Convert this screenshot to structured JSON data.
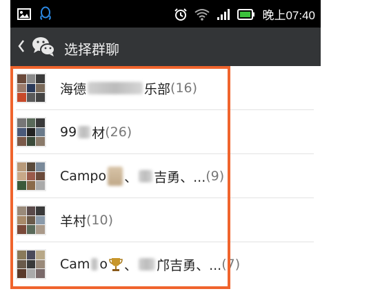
{
  "status_bar": {
    "time": "晚上07:40",
    "icons": [
      "image-icon",
      "qq-icon",
      "alarm-icon",
      "wifi-icon",
      "signal-icon",
      "battery-icon"
    ]
  },
  "header": {
    "back_icon": "chevron-left-icon",
    "app_icon": "wechat-icon",
    "title": "选择群聊"
  },
  "groups": [
    {
      "name_start": "海德",
      "name_end": "乐部",
      "count": "(16)",
      "avatar_colors": [
        "#6b4a3a",
        "#8a8a8a",
        "#3b3b3b",
        "#9b7b6b",
        "#2a3a5a",
        "#7a6a5a",
        "#c84a2a",
        "#5a5a5a",
        "#444"
      ]
    },
    {
      "name_start": "99",
      "name_end": "材",
      "count": "(26)",
      "avatar_colors": [
        "#777",
        "#5a6a5a",
        "#3a3a3a",
        "#4a5a7a",
        "#222",
        "#6a7a8a",
        "#7b5a4a",
        "#3a4a3a",
        "#8a7a6a"
      ]
    },
    {
      "name_start": "Campo",
      "sep1": "、",
      "mid": "吉勇",
      "sep2": "、...",
      "count": "(9)",
      "avatar_colors": [
        "#b89a7a",
        "#5a4a3a",
        "#7a8a9a",
        "#c8a888",
        "#9a5a4a",
        "#6a4a3a",
        "#3a5a3a",
        "#8a6a4a",
        "#aaa"
      ]
    },
    {
      "name_start": "羊村",
      "count": "(10)",
      "avatar_colors": [
        "#9a8a7a",
        "#5a4a4a",
        "#3a3a3a",
        "#a88a6a",
        "#6a5a4a",
        "#8a9aaa",
        "#7a4a3a",
        "#5a6a5a",
        "#aa9a8a"
      ]
    },
    {
      "name_start": "Cam",
      "mid_a": "o",
      "sep1": "、",
      "mid": "邝吉勇",
      "sep2": "、...",
      "count": "(7)",
      "avatar_colors": [
        "#8a7a5a",
        "#4a4a5a",
        "#b8a888",
        "#6a5a4a",
        "#3a3a3a",
        "#9a8a7a",
        "#5a3a2a",
        "#aaa",
        "#7a6a6a"
      ]
    }
  ],
  "highlight_color": "#f0642d"
}
